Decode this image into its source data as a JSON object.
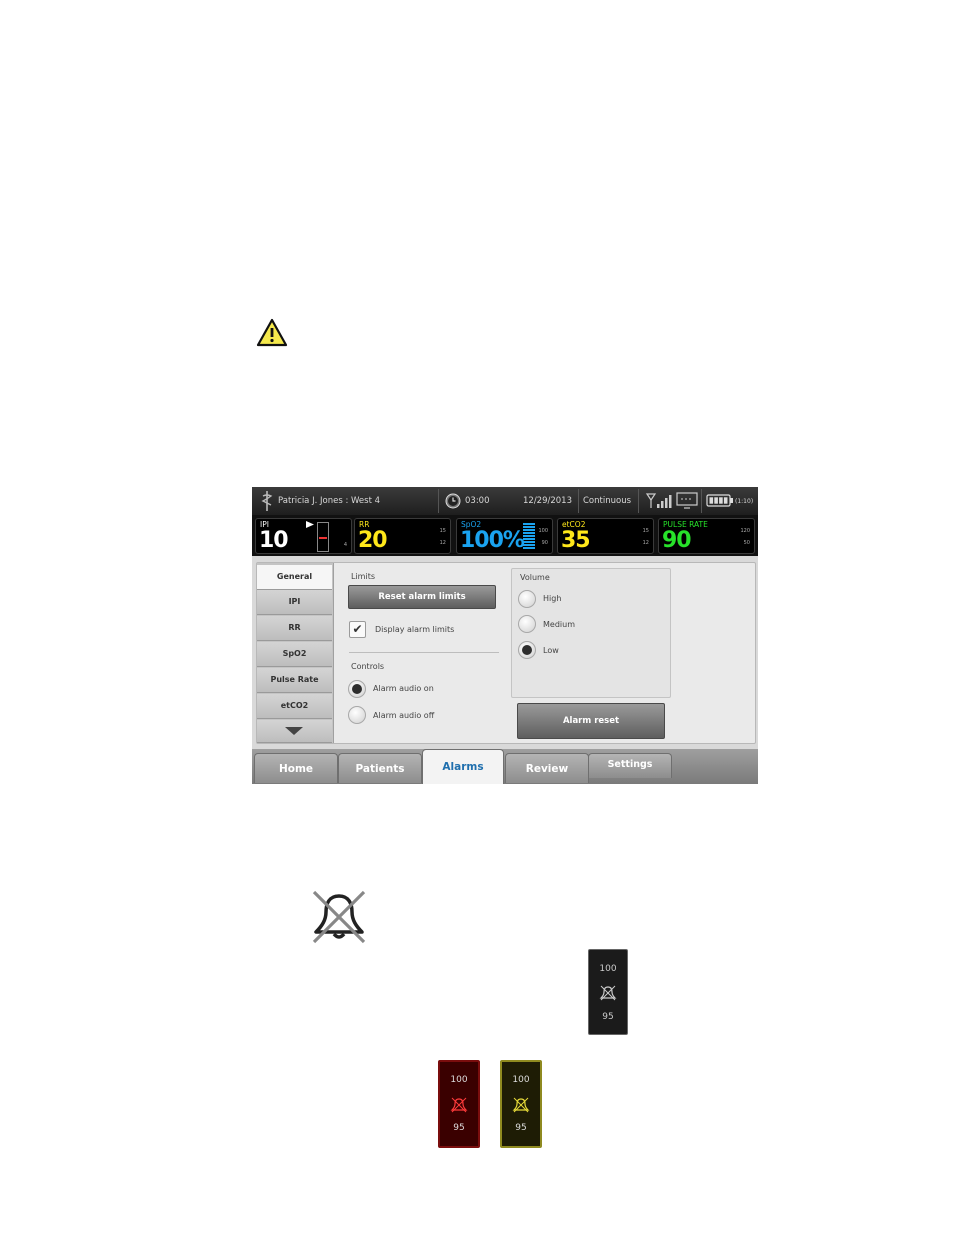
{
  "status_bar": {
    "patient": "Patricia J. Jones : West 4",
    "timer": "03:00",
    "date": "12/29/2013",
    "mode": "Continuous",
    "battery_time": "(1:10)"
  },
  "vitals": [
    {
      "label": "IPI",
      "value": "10",
      "limit_low": "4",
      "color": "#ffffff"
    },
    {
      "label": "RR",
      "value": "20",
      "limit_high": "15",
      "limit_low": "12",
      "color": "#ffe81a"
    },
    {
      "label": "SpO2",
      "value": "100%",
      "limit_high": "100",
      "limit_low": "90",
      "color": "#1aa3f0"
    },
    {
      "label": "etCO2",
      "value": "35",
      "limit_high": "15",
      "limit_low": "12",
      "color": "#ffe81a"
    },
    {
      "label": "PULSE RATE",
      "value": "90",
      "limit_high": "120",
      "limit_low": "50",
      "color": "#27e22a"
    }
  ],
  "vertical_tabs": [
    "General",
    "IPI",
    "RR",
    "SpO2",
    "Pulse Rate",
    "etCO2"
  ],
  "limits": {
    "heading": "Limits",
    "reset_button": "Reset alarm limits",
    "display_limits_label": "Display alarm limits",
    "display_limits_checked": true
  },
  "controls": {
    "heading": "Controls",
    "options": [
      "Alarm audio on",
      "Alarm audio off"
    ],
    "selected": "Alarm audio on"
  },
  "volume": {
    "heading": "Volume",
    "options": [
      "High",
      "Medium",
      "Low"
    ],
    "selected": "Low"
  },
  "alarm_reset_button": "Alarm reset",
  "nav_tabs": [
    "Home",
    "Patients",
    "Alarms",
    "Review",
    "Settings"
  ],
  "nav_selected": "Alarms",
  "mini_tiles": [
    {
      "top": "100",
      "bottom": "95",
      "color": "#cccccc"
    },
    {
      "top": "100",
      "bottom": "95",
      "color": "#ff3b3b"
    },
    {
      "top": "100",
      "bottom": "95",
      "color": "#e8dc3a"
    }
  ],
  "icons": [
    "caution-icon",
    "alarm-off-bell-icon",
    "clock-icon",
    "antenna-icon",
    "network-icon",
    "battery-icon",
    "chevron-down-icon",
    "checkmark-icon"
  ]
}
